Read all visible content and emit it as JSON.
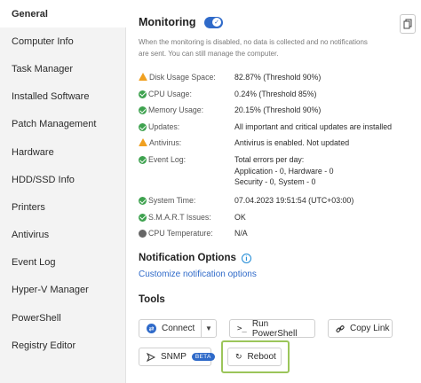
{
  "sidebar": {
    "items": [
      {
        "label": "General",
        "active": true
      },
      {
        "label": "Computer Info"
      },
      {
        "label": "Task Manager"
      },
      {
        "label": "Installed Software"
      },
      {
        "label": "Patch Management"
      },
      {
        "label": "Hardware"
      },
      {
        "label": "HDD/SSD Info"
      },
      {
        "label": "Printers"
      },
      {
        "label": "Antivirus"
      },
      {
        "label": "Event Log"
      },
      {
        "label": "Hyper-V Manager"
      },
      {
        "label": "PowerShell"
      },
      {
        "label": "Registry Editor"
      }
    ]
  },
  "monitoring": {
    "title": "Monitoring",
    "enabled": true,
    "note": "When the monitoring is disabled, no data is collected and no notifications are sent. You can still manage the computer."
  },
  "status": [
    {
      "icon": "warning-icon",
      "label": "Disk Usage Space:",
      "value": "82.87% (Threshold 90%)"
    },
    {
      "icon": "check-icon",
      "label": "CPU Usage:",
      "value": "0.24% (Threshold 85%)"
    },
    {
      "icon": "check-icon",
      "label": "Memory Usage:",
      "value": "20.15% (Threshold 90%)"
    },
    {
      "icon": "check-icon",
      "label": "Updates:",
      "value": "All important and critical updates are installed"
    },
    {
      "icon": "warning-icon",
      "label": "Antivirus:",
      "value": "Antivirus is enabled. Not updated"
    },
    {
      "icon": "check-icon",
      "label": "Event Log:",
      "value": "Total errors per day:",
      "value_lines": [
        "Application - 0, Hardware - 0",
        "Security - 0, System - 0"
      ]
    },
    {
      "icon": "check-icon",
      "label": "System Time:",
      "value": "07.04.2023 19:51:54 (UTC+03:00)"
    },
    {
      "icon": "check-icon",
      "label": "S.M.A.R.T Issues:",
      "value": "OK"
    },
    {
      "icon": "dot-icon",
      "label": "CPU Temperature:",
      "value": "N/A"
    }
  ],
  "notifications": {
    "title": "Notification Options",
    "link": "Customize notification options"
  },
  "tools": {
    "title": "Tools",
    "connect": "Connect",
    "run_powershell": "Run PowerShell",
    "copy_link": "Copy Link",
    "snmp": "SNMP",
    "snmp_badge": "BETA",
    "reboot": "Reboot"
  },
  "colors": {
    "accent": "#2f6ac9",
    "ok": "#3ea24f",
    "warning": "#f0a020",
    "highlight": "#9bc55a"
  }
}
